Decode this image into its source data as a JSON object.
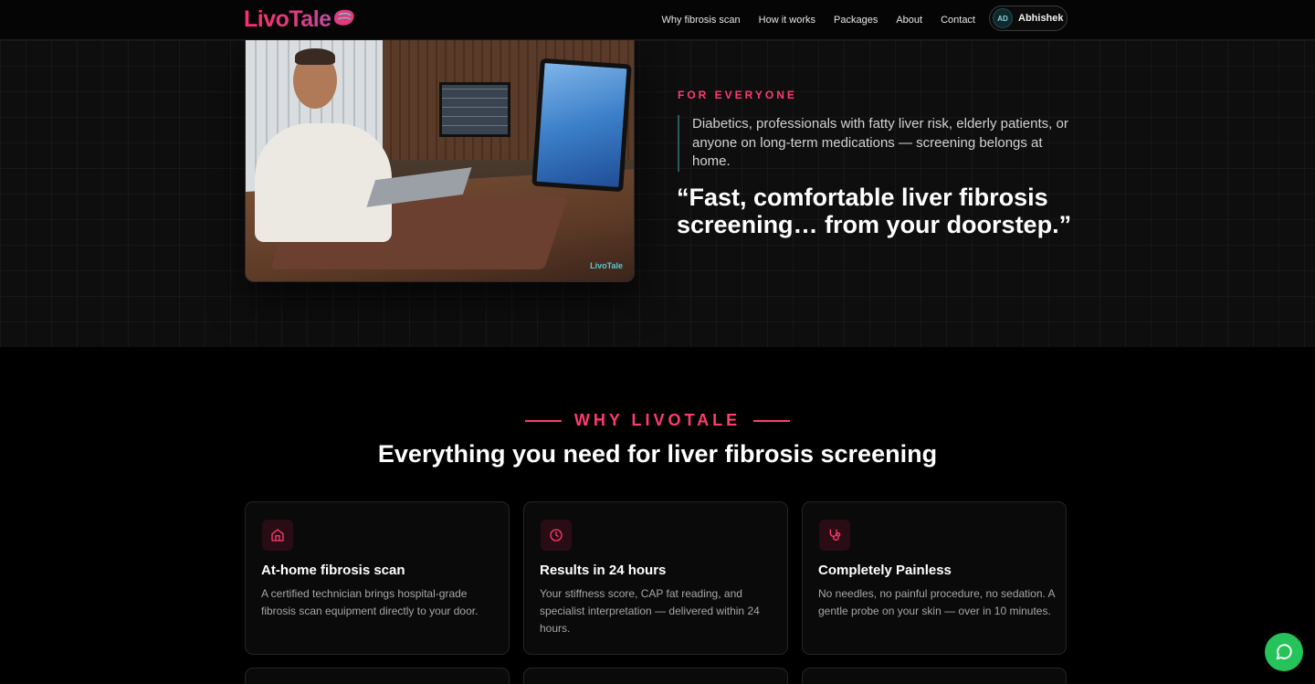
{
  "brand": {
    "name": "LivoTale"
  },
  "nav": {
    "links": [
      "Why fibrosis scan",
      "How it works",
      "Packages",
      "About",
      "Contact"
    ],
    "user": {
      "initials": "AD",
      "name": "Abhishek"
    }
  },
  "hero": {
    "photo_tag": "LivoTale",
    "eyebrow": "FOR EVERYONE",
    "description": "Diabetics, professionals with fatty liver risk, elderly patients, or anyone on long-term medications — screening belongs at home.",
    "quote": "“Fast, comfortable liver fibrosis screening… from your doorstep.”"
  },
  "why": {
    "eyebrow": "WHY LIVOTALE",
    "title": "Everything you need for liver fibrosis screening",
    "cards": [
      {
        "icon": "home-icon",
        "title": "At-home fibrosis scan",
        "text": "A certified technician brings hospital-grade fibrosis scan equipment directly to your door."
      },
      {
        "icon": "clock-icon",
        "title": "Results in 24 hours",
        "text": "Your stiffness score, CAP fat reading, and specialist interpretation — delivered within 24 hours."
      },
      {
        "icon": "stethoscope-icon",
        "title": "Completely Painless",
        "text": "No needles, no painful procedure, no sedation. A gentle probe on your skin — over in 10 minutes."
      }
    ]
  },
  "colors": {
    "accent": "#ff3b6e",
    "chat": "#25c35a"
  }
}
